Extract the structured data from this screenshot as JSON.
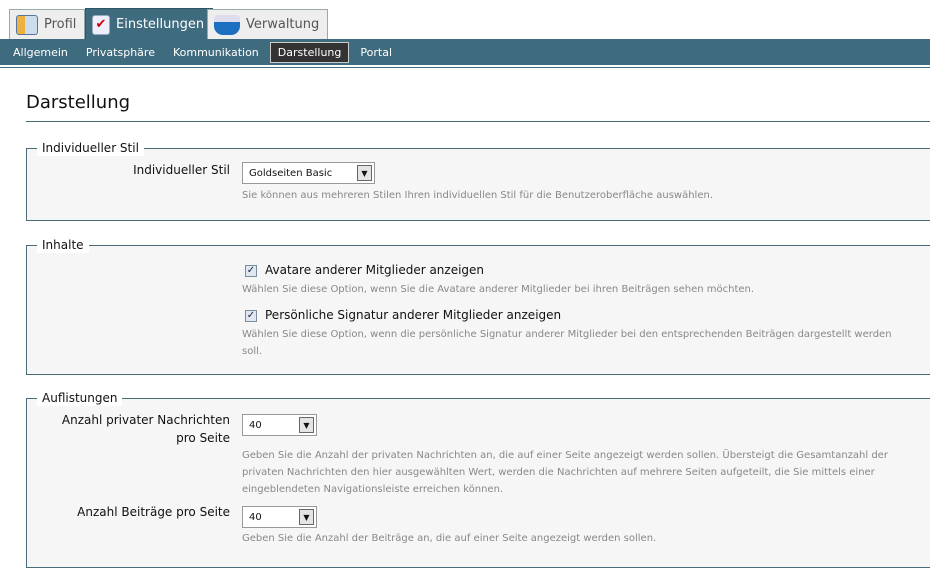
{
  "tabs": [
    {
      "label": "Profil",
      "icon": "profile-card-icon"
    },
    {
      "label": "Einstellungen",
      "icon": "checklist-icon"
    },
    {
      "label": "Verwaltung",
      "icon": "box-icon"
    }
  ],
  "subnav": [
    "Allgemein",
    "Privatsphäre",
    "Kommunikation",
    "Darstellung",
    "Portal"
  ],
  "title": "Darstellung",
  "sections": {
    "stil": {
      "legend": "Individueller Stil",
      "label": "Individueller Stil",
      "value": "Goldseiten Basic",
      "desc": "Sie können aus mehreren Stilen Ihren individuellen Stil für die Benutzeroberfläche auswählen."
    },
    "inhalte": {
      "legend": "Inhalte",
      "options": [
        {
          "label": "Avatare anderer Mitglieder anzeigen",
          "desc": "Wählen Sie diese Option, wenn Sie die Avatare anderer Mitglieder bei ihren Beiträgen sehen möchten.",
          "checked": true
        },
        {
          "label": "Persönliche Signatur anderer Mitglieder anzeigen",
          "desc": "Wählen Sie diese Option, wenn die persönliche Signatur anderer Mitglieder bei den entsprechenden Beiträgen dargestellt werden soll.",
          "checked": true
        }
      ]
    },
    "auflistungen": {
      "legend": "Auflistungen",
      "pm": {
        "label": "Anzahl privater Nachrichten pro Seite",
        "value": "40",
        "desc": "Geben Sie die Anzahl der privaten Nachrichten an, die auf einer Seite angezeigt werden sollen. Übersteigt die Gesamtanzahl der privaten Nachrichten den hier ausgewählten Wert, werden die Nachrichten auf mehrere Seiten aufgeteilt, die Sie mittels einer eingeblendeten Navigationsleiste erreichen können."
      },
      "posts": {
        "label": "Anzahl Beiträge pro Seite",
        "value": "40",
        "desc": "Geben Sie die Anzahl der Beiträge an, die auf einer Seite angezeigt werden sollen."
      }
    }
  }
}
